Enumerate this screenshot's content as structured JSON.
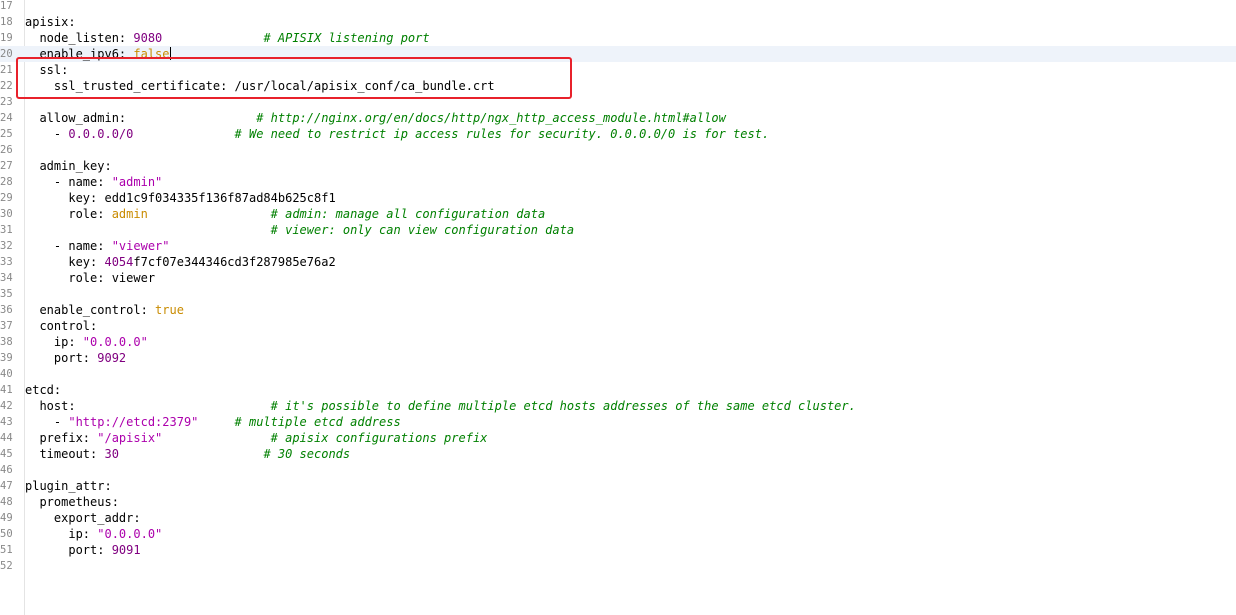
{
  "editor": {
    "language": "yaml",
    "current_line": 20,
    "highlight_color": "#e8212b",
    "highlighted_lines": [
      21,
      22
    ],
    "colors": {
      "number": "#800080",
      "string": "#ac00ac",
      "boolean": "#c98b00",
      "comment": "#008000",
      "current_line_bg": "#eef3fa"
    },
    "lines": [
      {
        "n": "17",
        "t": []
      },
      {
        "n": "18",
        "t": [
          {
            "k": "key",
            "v": "apisix:"
          }
        ]
      },
      {
        "n": "19",
        "t": [
          {
            "k": "key",
            "v": "  node_listen: "
          },
          {
            "k": "num",
            "v": "9080"
          },
          {
            "k": "text",
            "v": "              "
          },
          {
            "k": "comment",
            "v": "# APISIX listening port"
          }
        ]
      },
      {
        "n": "20",
        "t": [
          {
            "k": "key",
            "v": "  enable_ipv6: "
          },
          {
            "k": "bool",
            "v": "false"
          },
          {
            "k": "caret",
            "v": ""
          }
        ]
      },
      {
        "n": "21",
        "t": [
          {
            "k": "key",
            "v": "  ssl:"
          }
        ]
      },
      {
        "n": "22",
        "t": [
          {
            "k": "key",
            "v": "    ssl_trusted_certificate: "
          },
          {
            "k": "text",
            "v": "/usr/local/apisix_conf/ca_bundle.crt"
          }
        ]
      },
      {
        "n": "23",
        "t": []
      },
      {
        "n": "24",
        "t": [
          {
            "k": "key",
            "v": "  allow_admin:"
          },
          {
            "k": "text",
            "v": "                  "
          },
          {
            "k": "comment",
            "v": "# http://nginx.org/en/docs/http/ngx_http_access_module.html#allow"
          }
        ]
      },
      {
        "n": "25",
        "t": [
          {
            "k": "text",
            "v": "    - "
          },
          {
            "k": "num",
            "v": "0.0.0.0/0"
          },
          {
            "k": "text",
            "v": "              "
          },
          {
            "k": "comment",
            "v": "# We need to restrict ip access rules for security. 0.0.0.0/0 is for test."
          }
        ]
      },
      {
        "n": "26",
        "t": []
      },
      {
        "n": "27",
        "t": [
          {
            "k": "key",
            "v": "  admin_key:"
          }
        ]
      },
      {
        "n": "28",
        "t": [
          {
            "k": "text",
            "v": "    - name: "
          },
          {
            "k": "str",
            "v": "\"admin\""
          }
        ]
      },
      {
        "n": "29",
        "t": [
          {
            "k": "key",
            "v": "      key: "
          },
          {
            "k": "text",
            "v": "edd1c9f034335f136f87ad84b625c8f1"
          }
        ]
      },
      {
        "n": "30",
        "t": [
          {
            "k": "key",
            "v": "      role: "
          },
          {
            "k": "bool",
            "v": "admin"
          },
          {
            "k": "text",
            "v": "                 "
          },
          {
            "k": "comment",
            "v": "# admin: manage all configuration data"
          }
        ]
      },
      {
        "n": "31",
        "t": [
          {
            "k": "text",
            "v": "                                  "
          },
          {
            "k": "comment",
            "v": "# viewer: only can view configuration data"
          }
        ]
      },
      {
        "n": "32",
        "t": [
          {
            "k": "text",
            "v": "    - name: "
          },
          {
            "k": "str",
            "v": "\"viewer\""
          }
        ]
      },
      {
        "n": "33",
        "t": [
          {
            "k": "key",
            "v": "      key: "
          },
          {
            "k": "num",
            "v": "4054"
          },
          {
            "k": "text",
            "v": "f7cf07e344346cd3f287985e76a2"
          }
        ]
      },
      {
        "n": "34",
        "t": [
          {
            "k": "key",
            "v": "      role: "
          },
          {
            "k": "text",
            "v": "viewer"
          }
        ]
      },
      {
        "n": "35",
        "t": []
      },
      {
        "n": "36",
        "t": [
          {
            "k": "key",
            "v": "  enable_control: "
          },
          {
            "k": "bool",
            "v": "true"
          }
        ]
      },
      {
        "n": "37",
        "t": [
          {
            "k": "key",
            "v": "  control:"
          }
        ]
      },
      {
        "n": "38",
        "t": [
          {
            "k": "key",
            "v": "    ip: "
          },
          {
            "k": "str",
            "v": "\"0.0.0.0\""
          }
        ]
      },
      {
        "n": "39",
        "t": [
          {
            "k": "key",
            "v": "    port: "
          },
          {
            "k": "num",
            "v": "9092"
          }
        ]
      },
      {
        "n": "40",
        "t": []
      },
      {
        "n": "41",
        "t": [
          {
            "k": "key",
            "v": "etcd:"
          }
        ]
      },
      {
        "n": "42",
        "t": [
          {
            "k": "key",
            "v": "  host:"
          },
          {
            "k": "text",
            "v": "                           "
          },
          {
            "k": "comment",
            "v": "# it's possible to define multiple etcd hosts addresses of the same etcd cluster."
          }
        ]
      },
      {
        "n": "43",
        "t": [
          {
            "k": "text",
            "v": "    - "
          },
          {
            "k": "str",
            "v": "\"http://etcd:2379\""
          },
          {
            "k": "text",
            "v": "     "
          },
          {
            "k": "comment",
            "v": "# multiple etcd address"
          }
        ]
      },
      {
        "n": "44",
        "t": [
          {
            "k": "key",
            "v": "  prefix: "
          },
          {
            "k": "str",
            "v": "\"/apisix\""
          },
          {
            "k": "text",
            "v": "               "
          },
          {
            "k": "comment",
            "v": "# apisix configurations prefix"
          }
        ]
      },
      {
        "n": "45",
        "t": [
          {
            "k": "key",
            "v": "  timeout: "
          },
          {
            "k": "num",
            "v": "30"
          },
          {
            "k": "text",
            "v": "                    "
          },
          {
            "k": "comment",
            "v": "# 30 seconds"
          }
        ]
      },
      {
        "n": "46",
        "t": []
      },
      {
        "n": "47",
        "t": [
          {
            "k": "key",
            "v": "plugin_attr:"
          }
        ]
      },
      {
        "n": "48",
        "t": [
          {
            "k": "key",
            "v": "  prometheus:"
          }
        ]
      },
      {
        "n": "49",
        "t": [
          {
            "k": "key",
            "v": "    export_addr:"
          }
        ]
      },
      {
        "n": "50",
        "t": [
          {
            "k": "key",
            "v": "      ip: "
          },
          {
            "k": "str",
            "v": "\"0.0.0.0\""
          }
        ]
      },
      {
        "n": "51",
        "t": [
          {
            "k": "key",
            "v": "      port: "
          },
          {
            "k": "num",
            "v": "9091"
          }
        ]
      },
      {
        "n": "52",
        "t": []
      }
    ]
  }
}
